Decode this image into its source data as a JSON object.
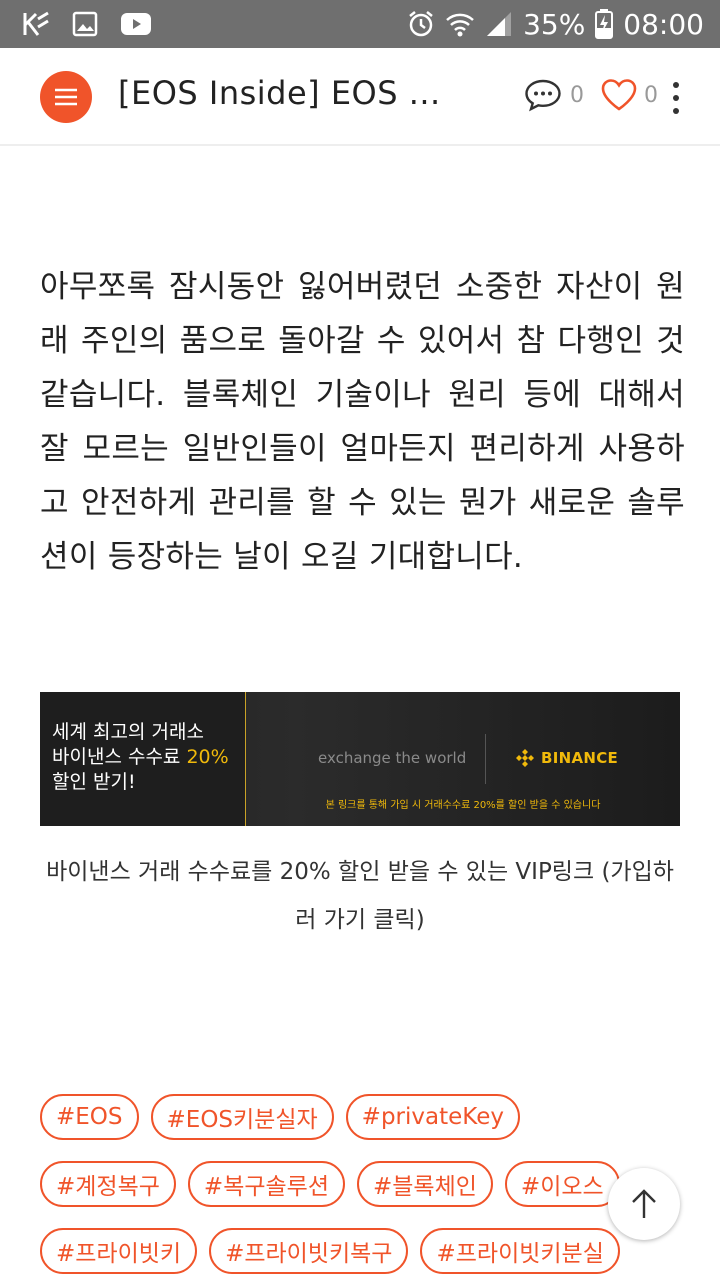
{
  "status_bar": {
    "battery": "35%",
    "time": "08:00",
    "icons": [
      "k-icon",
      "gallery-icon",
      "youtube-icon",
      "alarm-icon",
      "wifi-icon",
      "signal-icon",
      "battery-charging-icon"
    ]
  },
  "app_bar": {
    "title": "[EOS Inside] EOS ...",
    "comment_count": "0",
    "like_count": "0",
    "accent_color": "#f0542a"
  },
  "article": {
    "paragraph": "아무쪼록 잠시동안 잃어버렸던 소중한 자산이 원래 주인의 품으로 돌아갈 수 있어서 참 다행인 것 같습니다. 블록체인 기술이나 원리 등에 대해서 잘 모르는 일반인들이 얼마든지 편리하게 사용하고 안전하게 관리를 할 수 있는 뭔가 새로운 솔루션이 등장하는 날이 오길 기대합니다."
  },
  "banner": {
    "line1": "세계 최고의 거래소",
    "line2_prefix": "바이낸스 수수료 ",
    "line2_highlight": "20%",
    "line3": "할인 받기!",
    "tagline": "exchange the world",
    "brand": "BINANCE",
    "note": "본 링크를 통해 가입 시 거래수수료 20%를 할인 받을 수 있습니다",
    "brand_color": "#f0b90b"
  },
  "caption": "바이낸스 거래 수수료를 20% 할인 받을 수 있는 VIP링크 (가입하러 가기 클릭)",
  "tags": {
    "row1": [
      "#EOS",
      "#EOS키분실자",
      "#privateKey"
    ],
    "row2": [
      "#계정복구",
      "#복구솔루션",
      "#블록체인",
      "#이오스"
    ],
    "row3": [
      "#프라이빗키",
      "#프라이빗키복구",
      "#프라이빗키분실"
    ]
  }
}
